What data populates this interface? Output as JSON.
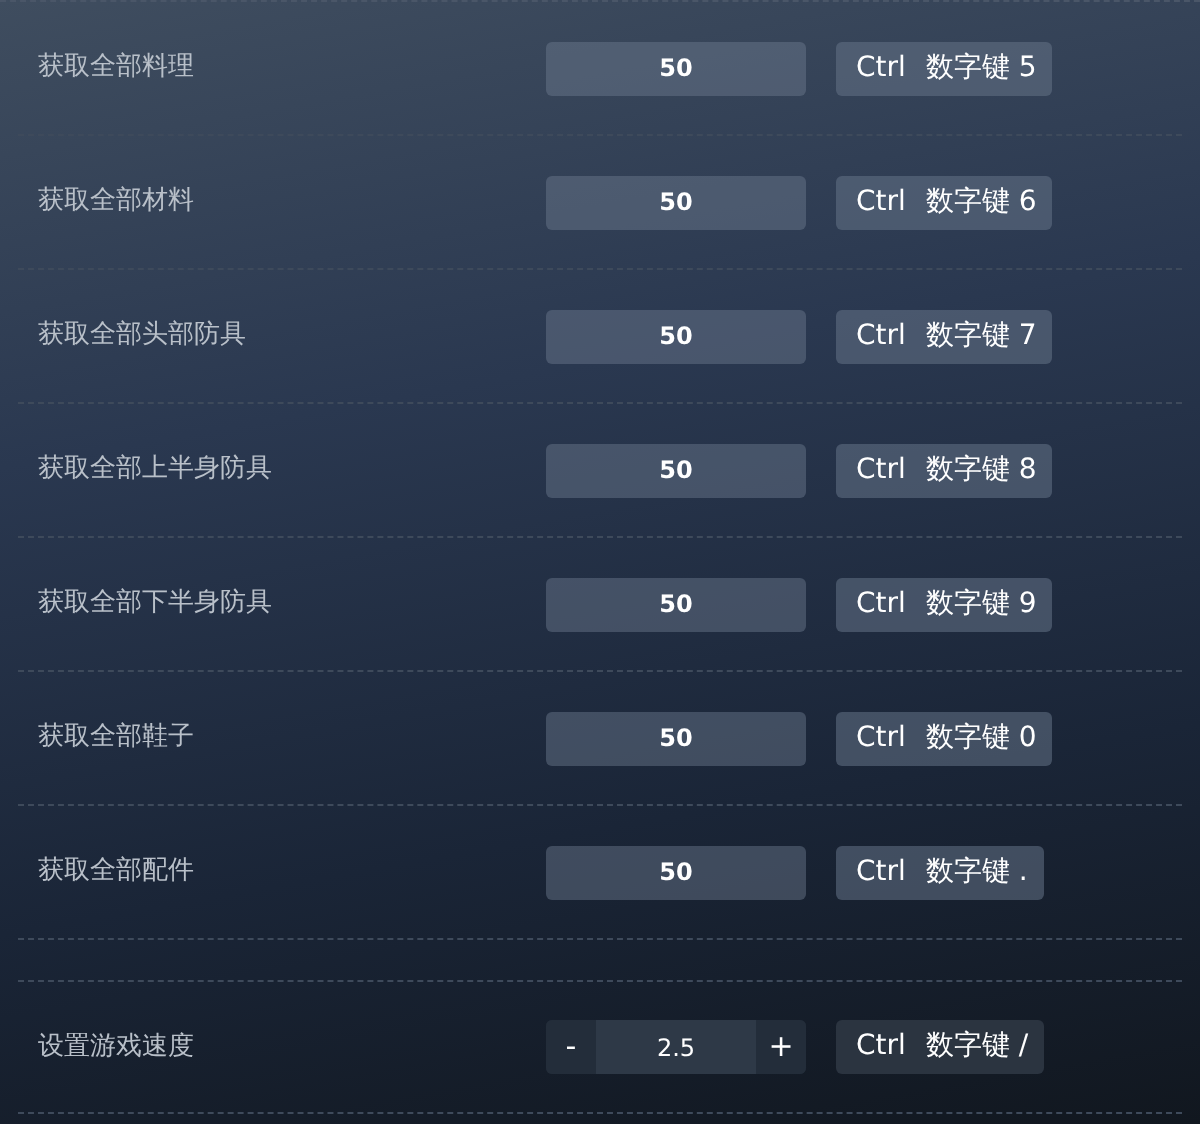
{
  "rows": [
    {
      "kind": "number",
      "label": "获取全部料理",
      "value": "50",
      "modifier": "Ctrl",
      "key": "数字键 5"
    },
    {
      "kind": "number",
      "label": "获取全部材料",
      "value": "50",
      "modifier": "Ctrl",
      "key": "数字键 6"
    },
    {
      "kind": "number",
      "label": "获取全部头部防具",
      "value": "50",
      "modifier": "Ctrl",
      "key": "数字键 7"
    },
    {
      "kind": "number",
      "label": "获取全部上半身防具",
      "value": "50",
      "modifier": "Ctrl",
      "key": "数字键 8"
    },
    {
      "kind": "number",
      "label": "获取全部下半身防具",
      "value": "50",
      "modifier": "Ctrl",
      "key": "数字键 9"
    },
    {
      "kind": "number",
      "label": "获取全部鞋子",
      "value": "50",
      "modifier": "Ctrl",
      "key": "数字键 0"
    },
    {
      "kind": "number",
      "label": "获取全部配件",
      "value": "50",
      "modifier": "Ctrl",
      "key": "数字键 ."
    },
    {
      "kind": "stepper",
      "label": "设置游戏速度",
      "value": "2.5",
      "minus": "-",
      "plus": "+",
      "modifier": "Ctrl",
      "key": "数字键 /"
    }
  ]
}
